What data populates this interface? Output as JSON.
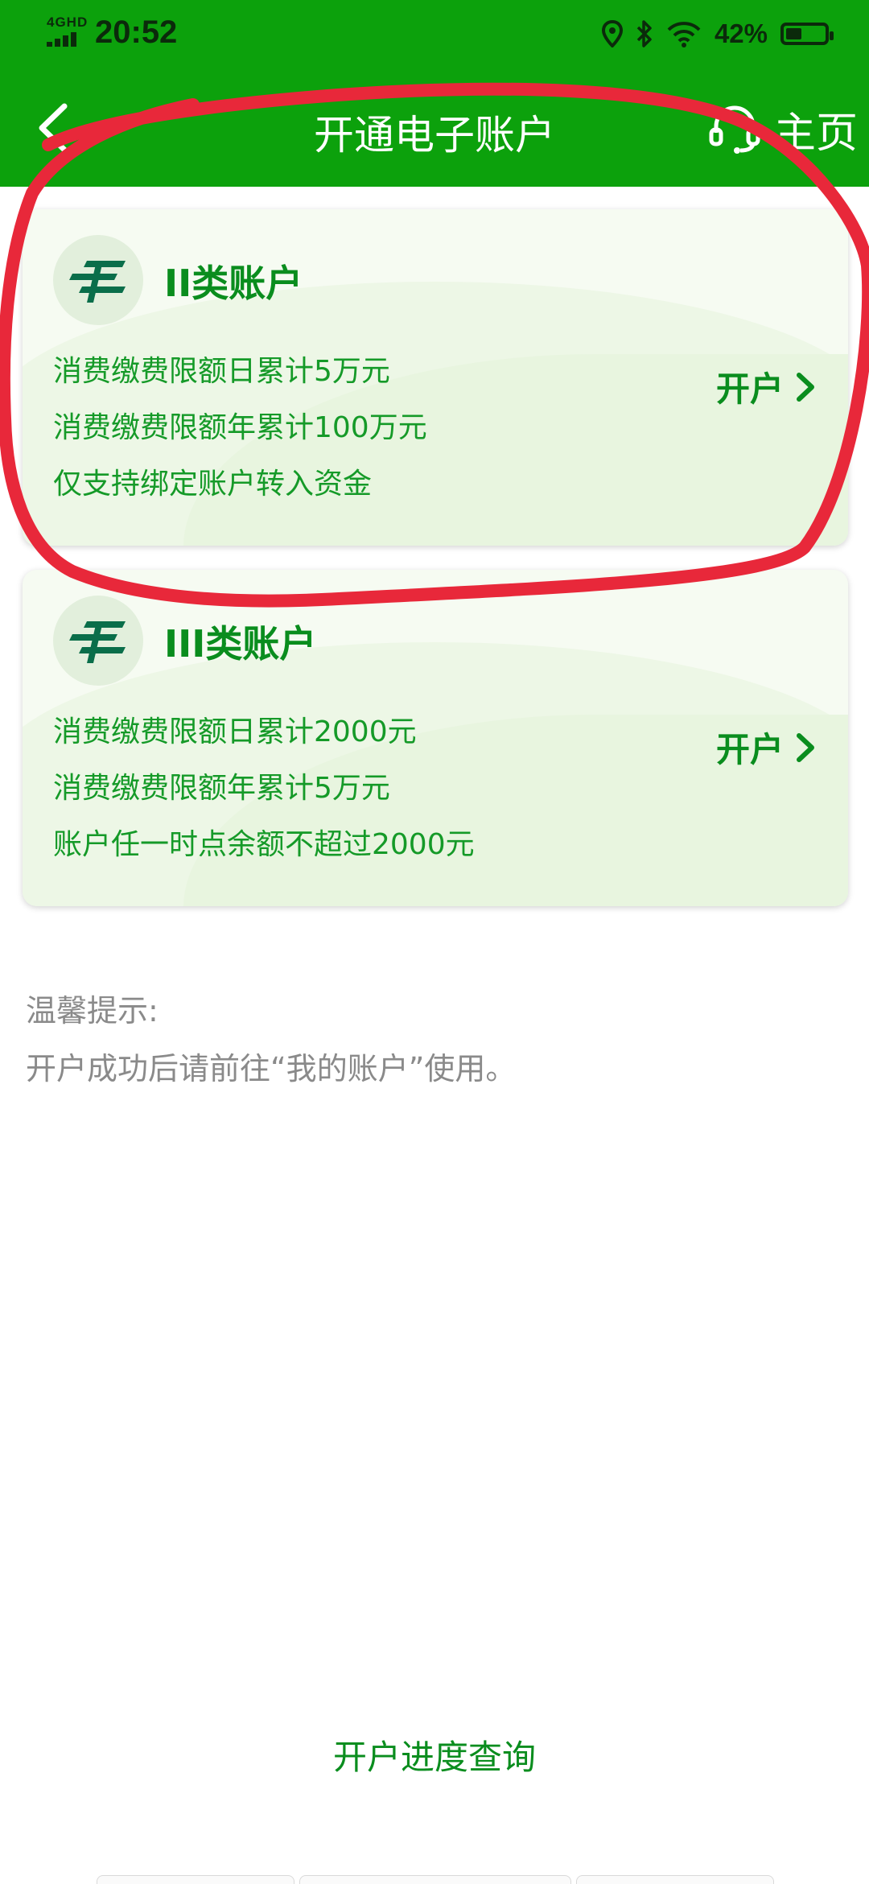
{
  "status_bar": {
    "network": "4GHD",
    "time": "20:52",
    "battery_percent": "42%",
    "battery_level": 0.42
  },
  "header": {
    "title": "开通电子账户",
    "home_label": "主页"
  },
  "cards": [
    {
      "title": "II类账户",
      "features": [
        "消费缴费限额日累计5万元",
        "消费缴费限额年累计100万元",
        "仅支持绑定账户转入资金"
      ],
      "action": "开户"
    },
    {
      "title": "III类账户",
      "features": [
        "消费缴费限额日累计2000元",
        "消费缴费限额年累计5万元",
        "账户任一时点余额不超过2000元"
      ],
      "action": "开户"
    }
  ],
  "tips": {
    "title": "温馨提示:",
    "text": "开户成功后请前往“我的账户”使用。"
  },
  "progress_link": "开户进度查询",
  "colors": {
    "header_green": "#0ca10c",
    "accent_green": "#0a8d1e",
    "annotation_red": "#e8283a"
  }
}
